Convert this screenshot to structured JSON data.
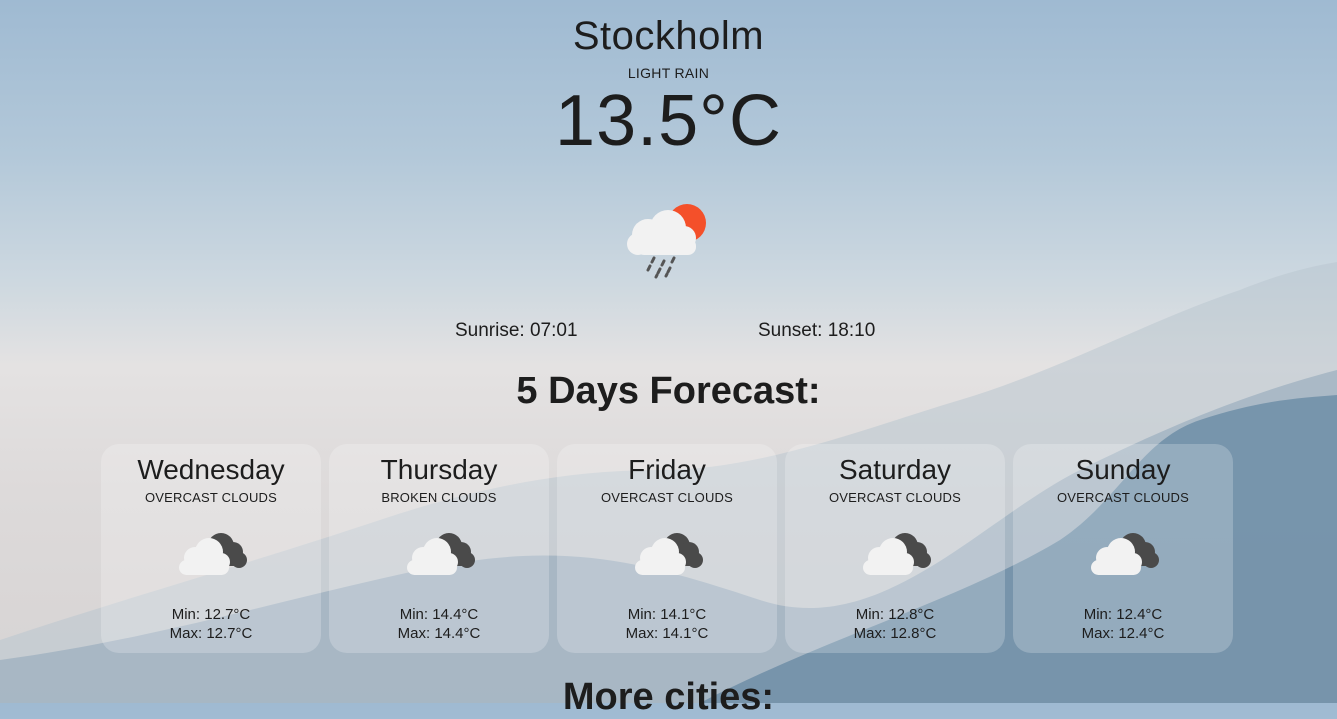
{
  "current": {
    "city": "Stockholm",
    "condition": "LIGHT RAIN",
    "temperature": "13.5°C",
    "icon": "cloud-sun-rain-icon",
    "sunrise": "Sunrise: 07:01",
    "sunset": "Sunset: 18:10"
  },
  "forecast": {
    "title": "5 Days Forecast:",
    "days": [
      {
        "day": "Wednesday",
        "desc": "OVERCAST CLOUDS",
        "icon": "overcast-clouds-icon",
        "min": "Min: 12.7°C",
        "max": "Max: 12.7°C"
      },
      {
        "day": "Thursday",
        "desc": "BROKEN CLOUDS",
        "icon": "overcast-clouds-icon",
        "min": "Min: 14.4°C",
        "max": "Max: 14.4°C"
      },
      {
        "day": "Friday",
        "desc": "OVERCAST CLOUDS",
        "icon": "overcast-clouds-icon",
        "min": "Min: 14.1°C",
        "max": "Max: 14.1°C"
      },
      {
        "day": "Saturday",
        "desc": "OVERCAST CLOUDS",
        "icon": "overcast-clouds-icon",
        "min": "Min: 12.8°C",
        "max": "Max: 12.8°C"
      },
      {
        "day": "Sunday",
        "desc": "OVERCAST CLOUDS",
        "icon": "overcast-clouds-icon",
        "min": "Min: 12.4°C",
        "max": "Max: 12.4°C"
      }
    ]
  },
  "more_cities": {
    "title": "More cities:"
  },
  "colors": {
    "sun": "#f4502a",
    "cloud_white": "#f2f2f2",
    "cloud_dark": "#4a4a4a",
    "mountain": "#6f8ea7"
  }
}
